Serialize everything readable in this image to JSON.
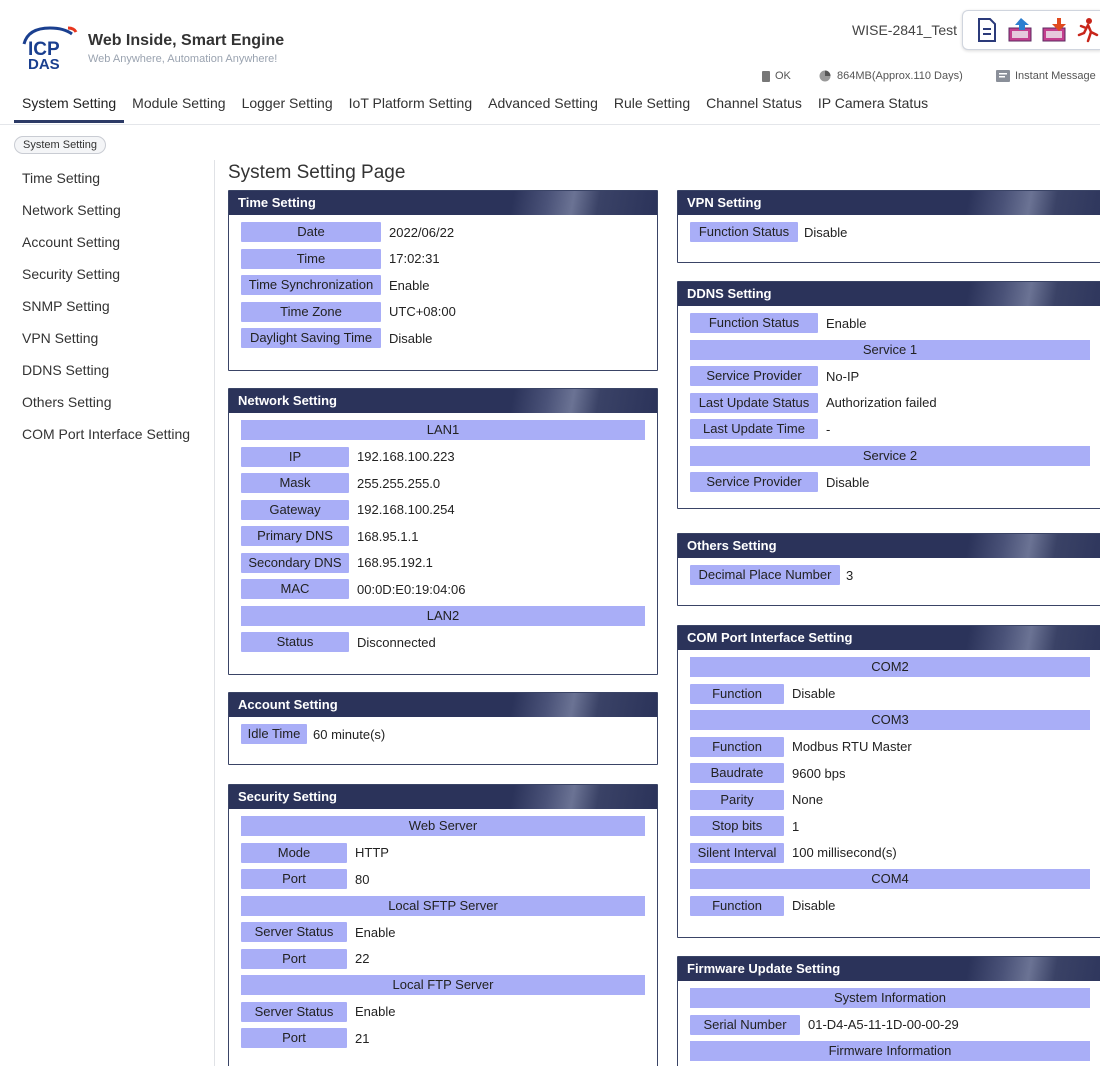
{
  "header": {
    "brand_title": "Web Inside, Smart Engine",
    "brand_subtitle": "Web Anywhere, Automation Anywhere!",
    "logo_text_top": "ICP",
    "logo_text_bottom": "DAS",
    "device_name": "WISE-2841_Test",
    "toolbar": [
      "document-icon",
      "upload-icon",
      "download-icon",
      "logout-icon"
    ],
    "status_ok": "OK",
    "status_memory": "864MB(Approx.110 Days)",
    "status_message": "Instant Message"
  },
  "nav": {
    "tabs": [
      "System Setting",
      "Module Setting",
      "Logger Setting",
      "IoT Platform Setting",
      "Advanced Setting",
      "Rule Setting",
      "Channel Status",
      "IP Camera Status"
    ],
    "active": "System Setting"
  },
  "breadcrumb": "System Setting",
  "sidebar": {
    "items": [
      "Time Setting",
      "Network Setting",
      "Account Setting",
      "Security Setting",
      "SNMP Setting",
      "VPN Setting",
      "DDNS Setting",
      "Others Setting",
      "COM Port Interface Setting"
    ]
  },
  "page_title": "System Setting Page",
  "time": {
    "title": "Time Setting",
    "rows": [
      {
        "label": "Date",
        "value": "2022/06/22"
      },
      {
        "label": "Time",
        "value": "17:02:31"
      },
      {
        "label": "Time Synchronization",
        "value": "Enable"
      },
      {
        "label": "Time Zone",
        "value": "UTC+08:00"
      },
      {
        "label": "Daylight Saving Time",
        "value": "Disable"
      }
    ]
  },
  "network": {
    "title": "Network Setting",
    "lan1": "LAN1",
    "rows": [
      {
        "label": "IP",
        "value": "192.168.100.223"
      },
      {
        "label": "Mask",
        "value": "255.255.255.0"
      },
      {
        "label": "Gateway",
        "value": "192.168.100.254"
      },
      {
        "label": "Primary DNS",
        "value": "168.95.1.1"
      },
      {
        "label": "Secondary DNS",
        "value": "168.95.192.1"
      },
      {
        "label": "MAC",
        "value": "00:0D:E0:19:04:06"
      }
    ],
    "lan2": "LAN2",
    "lan2_rows": [
      {
        "label": "Status",
        "value": "Disconnected"
      }
    ]
  },
  "account": {
    "title": "Account Setting",
    "rows": [
      {
        "label": "Idle Time",
        "value": "60 minute(s)"
      }
    ]
  },
  "security": {
    "title": "Security Setting",
    "web_server": "Web Server",
    "web_rows": [
      {
        "label": "Mode",
        "value": "HTTP"
      },
      {
        "label": "Port",
        "value": "80"
      }
    ],
    "sftp": "Local SFTP Server",
    "sftp_rows": [
      {
        "label": "Server Status",
        "value": "Enable"
      },
      {
        "label": "Port",
        "value": "22"
      }
    ],
    "ftp": "Local FTP Server",
    "ftp_rows": [
      {
        "label": "Server Status",
        "value": "Enable"
      },
      {
        "label": "Port",
        "value": "21"
      }
    ]
  },
  "vpn": {
    "title": "VPN Setting",
    "rows": [
      {
        "label": "Function Status",
        "value": "Disable"
      }
    ]
  },
  "ddns": {
    "title": "DDNS Setting",
    "rows": [
      {
        "label": "Function Status",
        "value": "Enable"
      }
    ],
    "service1": "Service 1",
    "service1_rows": [
      {
        "label": "Service Provider",
        "value": "No-IP"
      },
      {
        "label": "Last Update Status",
        "value": "Authorization failed"
      },
      {
        "label": "Last Update Time",
        "value": "-"
      }
    ],
    "service2": "Service 2",
    "service2_rows": [
      {
        "label": "Service Provider",
        "value": "Disable"
      }
    ]
  },
  "others": {
    "title": "Others Setting",
    "rows": [
      {
        "label": "Decimal Place Number",
        "value": "3"
      }
    ]
  },
  "com": {
    "title": "COM Port Interface Setting",
    "com2": "COM2",
    "com2_rows": [
      {
        "label": "Function",
        "value": "Disable"
      }
    ],
    "com3": "COM3",
    "com3_rows": [
      {
        "label": "Function",
        "value": "Modbus RTU Master"
      },
      {
        "label": "Baudrate",
        "value": "9600 bps"
      },
      {
        "label": "Parity",
        "value": "None"
      },
      {
        "label": "Stop bits",
        "value": "1"
      },
      {
        "label": "Silent Interval",
        "value": "100 millisecond(s)"
      }
    ],
    "com4": "COM4",
    "com4_rows": [
      {
        "label": "Function",
        "value": "Disable"
      }
    ]
  },
  "firmware": {
    "title": "Firmware Update Setting",
    "system_info": "System Information",
    "rows": [
      {
        "label": "Serial Number",
        "value": "01-D4-A5-11-1D-00-00-29"
      }
    ],
    "firmware_info": "Firmware Information"
  },
  "colors": {
    "panel_header": "#2b335a",
    "label_bg": "#a9aef7",
    "active_tab": "#2c3a66"
  }
}
